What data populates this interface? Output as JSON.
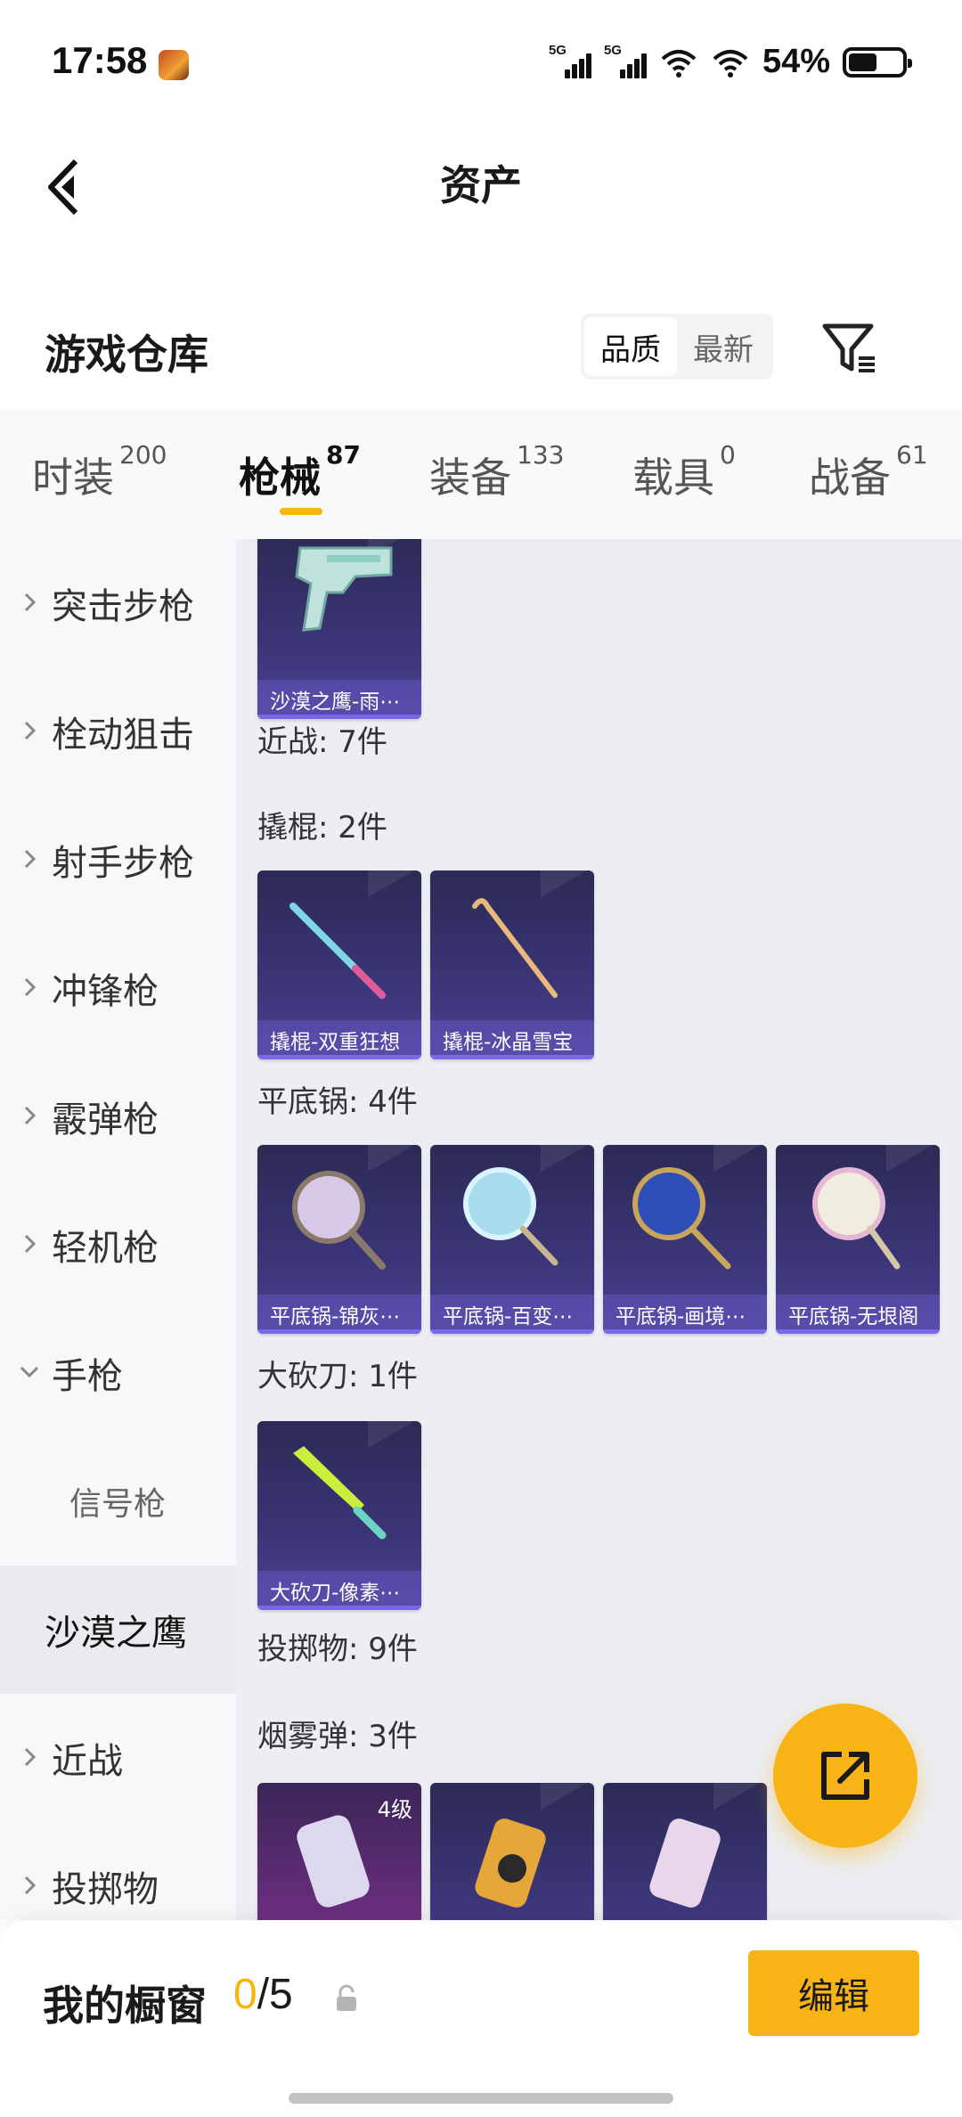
{
  "status_bar": {
    "time": "17:58",
    "network_1": "5G",
    "network_2": "5G",
    "battery_percent": "54%",
    "battery_level": 0.54
  },
  "nav": {
    "title": "资产"
  },
  "header": {
    "title": "游戏仓库",
    "sort_options": [
      "品质",
      "最新"
    ],
    "active_sort": "品质"
  },
  "tabs": [
    {
      "label": "时装",
      "count": "200"
    },
    {
      "label": "枪械",
      "count": "87",
      "active": true
    },
    {
      "label": "装备",
      "count": "133"
    },
    {
      "label": "载具",
      "count": "0"
    },
    {
      "label": "战备",
      "count": "61"
    }
  ],
  "sidebar": {
    "items": [
      {
        "label": "突击步枪"
      },
      {
        "label": "栓动狙击"
      },
      {
        "label": "射手步枪"
      },
      {
        "label": "冲锋枪"
      },
      {
        "label": "霰弹枪"
      },
      {
        "label": "轻机枪"
      },
      {
        "label": "手枪"
      },
      {
        "label": "信号枪"
      },
      {
        "label": "沙漠之鹰"
      },
      {
        "label": "近战"
      },
      {
        "label": "投掷物"
      }
    ]
  },
  "content": {
    "desert_eagle_card": "沙漠之鹰-雨⋯",
    "group_melee": "近战: 7件",
    "group_crowbar": "撬棍: 2件",
    "crowbar_cards": [
      "撬棍-双重狂想",
      "撬棍-冰晶雪宝"
    ],
    "group_pan": "平底锅: 4件",
    "pan_cards": [
      "平底锅-锦灰⋯",
      "平底锅-百变⋯",
      "平底锅-画境⋯",
      "平底锅-无垠阁"
    ],
    "group_machete": "大砍刀: 1件",
    "machete_cards": [
      "大砍刀-像素⋯"
    ],
    "group_throwable": "投掷物: 9件",
    "group_smoke": "烟雾弹: 3件",
    "smoke_level": "4级"
  },
  "bottom": {
    "label": "我的橱窗",
    "current": "0",
    "sep_total": "/5",
    "edit_label": "编辑"
  },
  "colors": {
    "accent": "#f8b316",
    "card": "#3b3578",
    "caption": "#7a68e8"
  }
}
